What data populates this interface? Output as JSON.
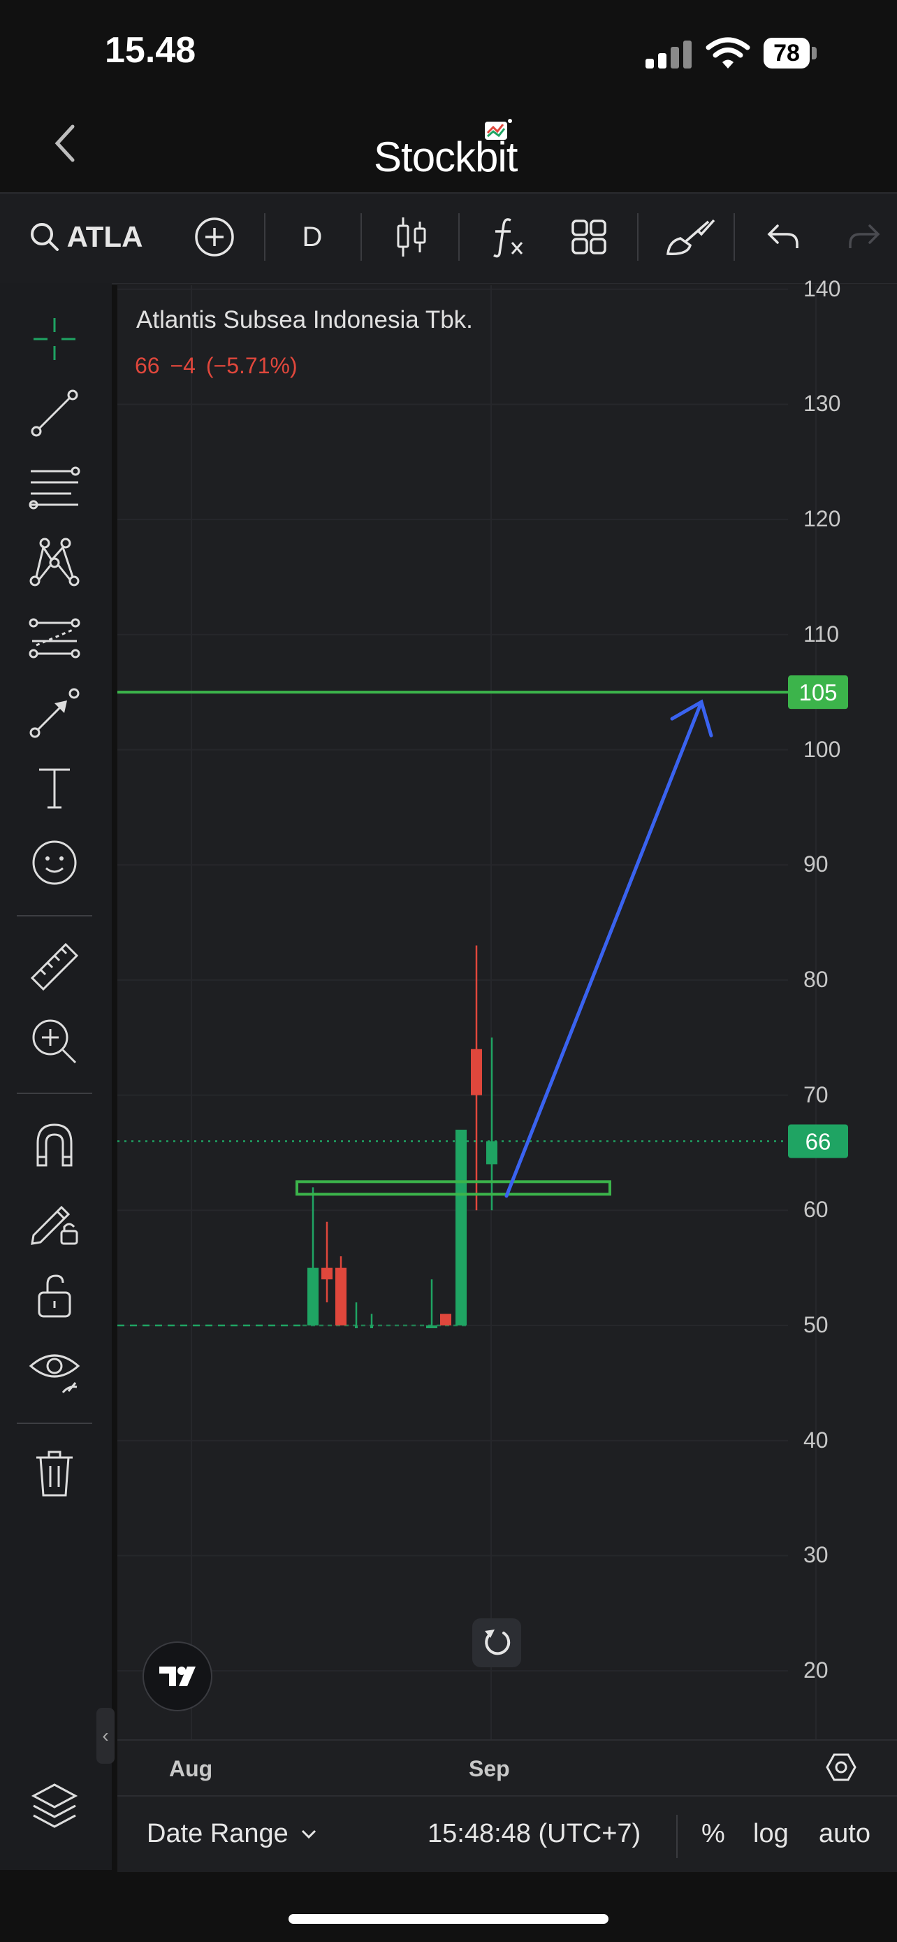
{
  "status_bar": {
    "time": "15.48",
    "battery": "78"
  },
  "header": {
    "title": "Stockbit"
  },
  "toolbar": {
    "symbol": "ATLA",
    "timeframe": "D"
  },
  "chart": {
    "company": "Atlantis Subsea Indonesia Tbk.",
    "quote": {
      "last": "66",
      "change": "−4",
      "change_pct": "(−5.71%)"
    },
    "price_badge": "66",
    "level_badge": "105",
    "colors": {
      "up": "#1fa463",
      "down": "#e0473c",
      "arrow": "#3a63f0",
      "level": "#3cb44b"
    }
  },
  "chart_data": {
    "type": "candlestick",
    "y_ticks": [
      "140",
      "130",
      "120",
      "110",
      "100",
      "90",
      "80",
      "70",
      "60",
      "50",
      "40",
      "30",
      "20"
    ],
    "x_ticks": [
      "Aug",
      "Sep"
    ],
    "candles": [
      {
        "open": 50,
        "high": 62,
        "low": 50,
        "close": 55,
        "dir": "up"
      },
      {
        "open": 55,
        "high": 59,
        "low": 52,
        "close": 54,
        "dir": "down"
      },
      {
        "open": 55,
        "high": 56,
        "low": 50,
        "close": 50,
        "dir": "down"
      },
      {
        "open": 50,
        "high": 52,
        "low": 50,
        "close": 50,
        "dir": "up"
      },
      {
        "open": 50,
        "high": 51,
        "low": 50,
        "close": 50,
        "dir": "up"
      },
      {
        "open": 50,
        "high": 54,
        "low": 50,
        "close": 50,
        "dir": "up"
      },
      {
        "open": 51,
        "high": 51,
        "low": 50,
        "close": 50,
        "dir": "down"
      },
      {
        "open": 50,
        "high": 67,
        "low": 50,
        "close": 67,
        "dir": "up"
      },
      {
        "open": 74,
        "high": 83,
        "low": 60,
        "close": 70,
        "dir": "down"
      },
      {
        "open": 64,
        "high": 75,
        "low": 60,
        "close": 66,
        "dir": "up"
      }
    ],
    "last_price": 66,
    "resistance_level": 105,
    "zone": {
      "low": 61,
      "high": 62
    }
  },
  "bottom": {
    "date_range": "Date Range",
    "clock": "15:48:48 (UTC+7)",
    "percent": "%",
    "log": "log",
    "auto": "auto"
  }
}
